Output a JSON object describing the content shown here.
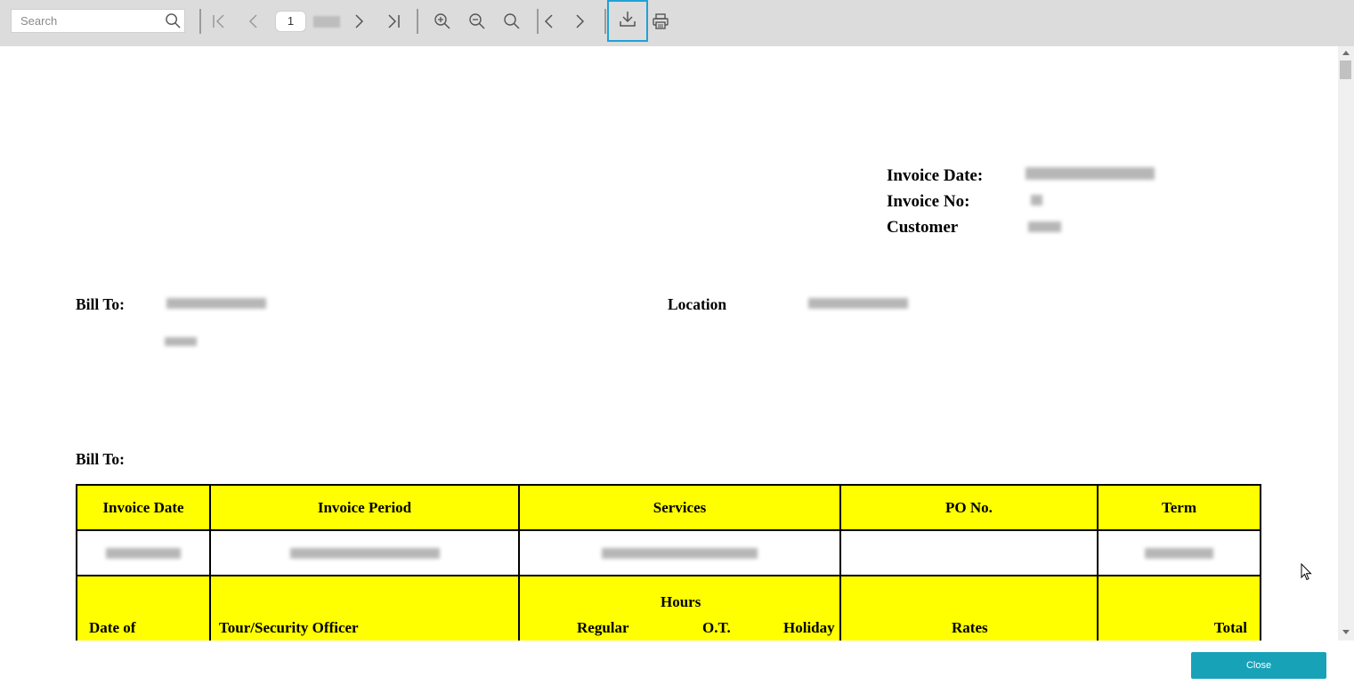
{
  "toolbar": {
    "search_placeholder": "Search",
    "page_number": "1",
    "icons": [
      "search-icon",
      "first-page-icon",
      "previous-page-icon",
      "next-page-icon",
      "last-page-icon",
      "zoom-in-icon",
      "zoom-out-icon",
      "zoom-fit-icon",
      "back-icon",
      "forward-icon",
      "download-icon",
      "print-icon"
    ],
    "highlight_color": "#1fa2d6"
  },
  "document": {
    "invoice_date_label": "Invoice Date:",
    "invoice_no_label": "Invoice No:",
    "customer_label": "Customer",
    "bill_to_label": "Bill To:",
    "location_label": "Location",
    "bill_to_label_2": "Bill To:",
    "table": {
      "headers": [
        "Invoice Date",
        "Invoice Period",
        "Services",
        "PO No.",
        "Term"
      ],
      "hours_label": "Hours",
      "header_row2": {
        "date_of": "Date of",
        "officer": "Tour/Security Officer",
        "regular": "Regular",
        "ot": "O.T.",
        "holiday": "Holiday",
        "rates": "Rates",
        "total": "Total"
      }
    },
    "highlight_fill": "#ffff00"
  },
  "footer": {
    "close_label": "Close",
    "close_color": "#17a2b8"
  }
}
